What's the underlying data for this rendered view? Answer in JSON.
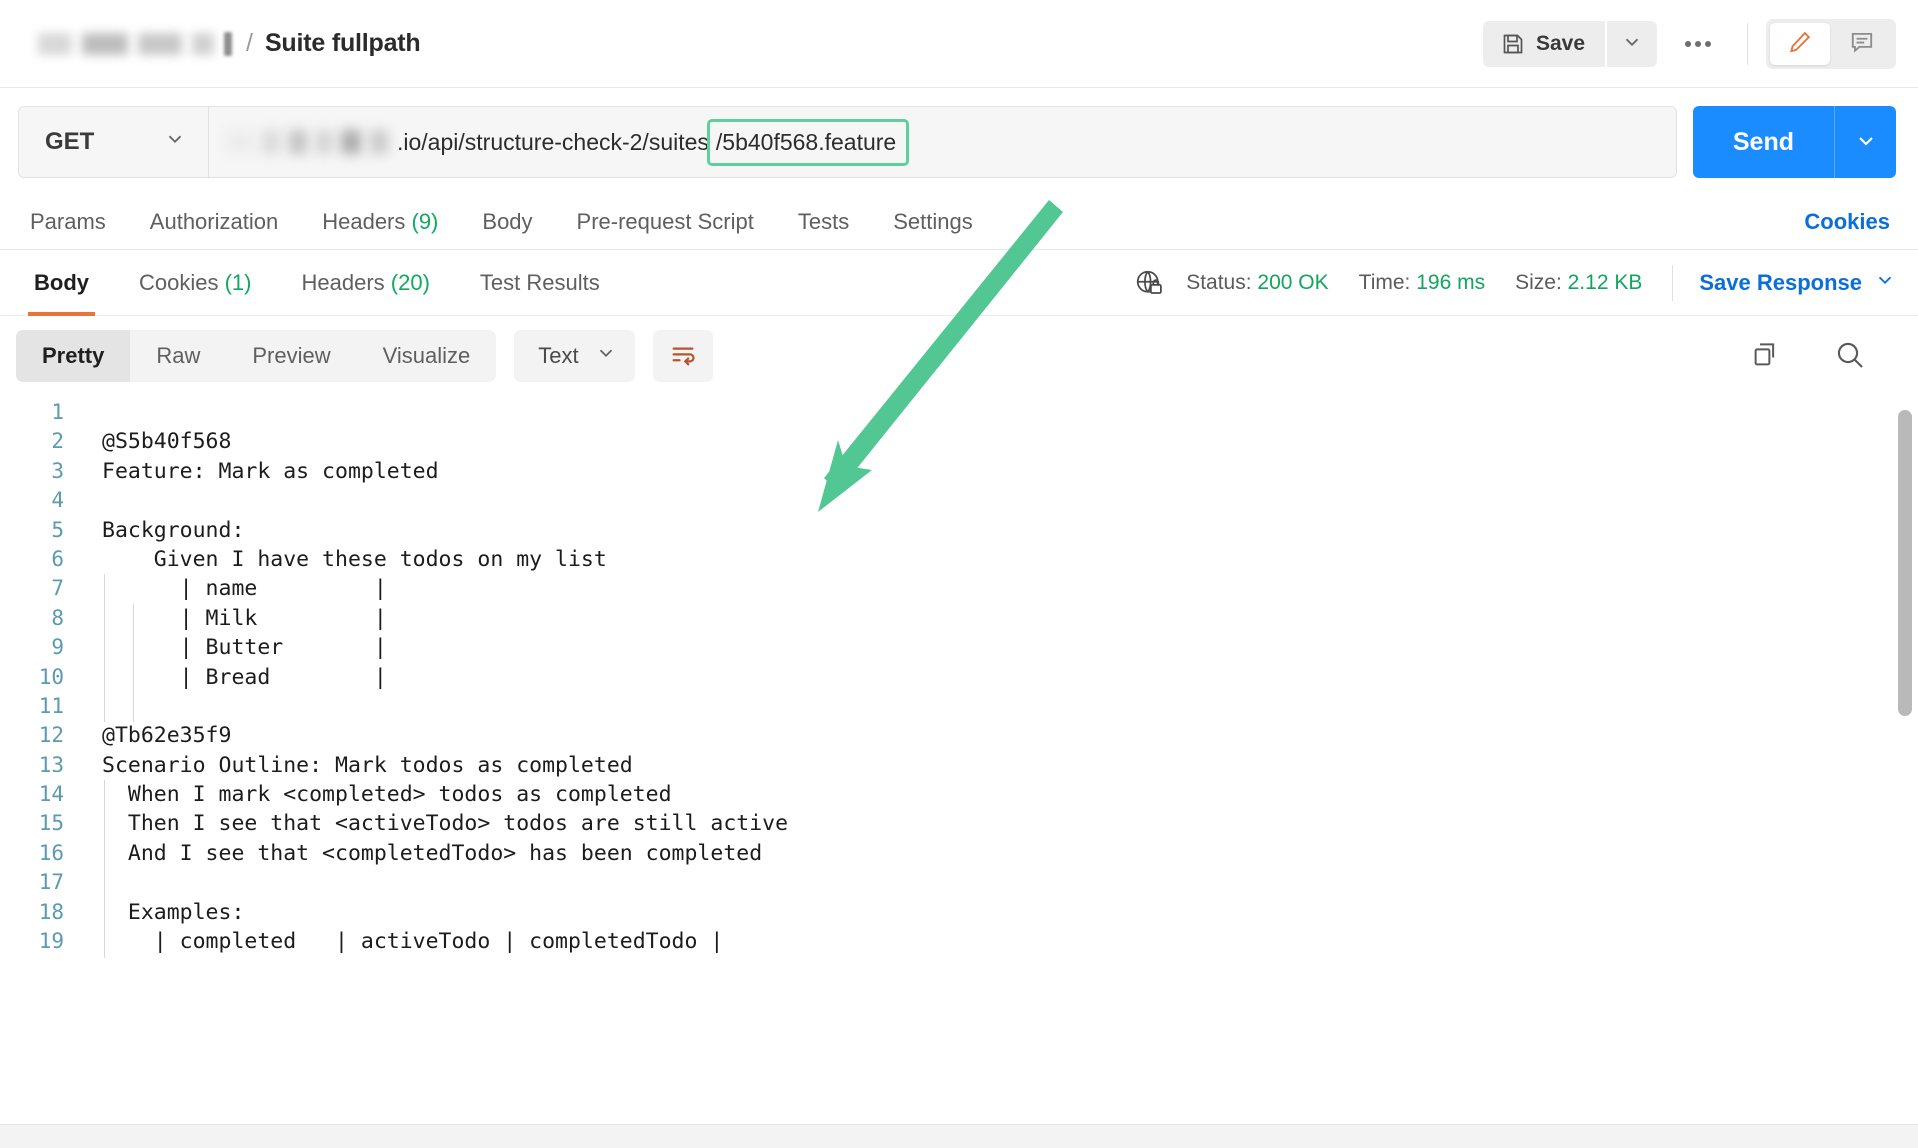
{
  "header": {
    "breadcrumb_redacted": true,
    "breadcrumb_separator": "/",
    "title": "Suite fullpath",
    "save_label": "Save",
    "save_caret_icon": "chevron-down-icon",
    "save_icon": "floppy-disk-icon",
    "more_icon": "three-dots-icon",
    "edit_icon": "pencil-icon",
    "comment_icon": "comment-icon"
  },
  "request": {
    "method": "GET",
    "method_caret_icon": "chevron-down-icon",
    "url_visible": ".io/api/structure-check-2/suites",
    "url_highlighted": "/5b40f568.feature",
    "highlight_color": "#5ecf9d",
    "send_label": "Send",
    "send_caret_icon": "chevron-down-icon",
    "send_color": "#1a8cff",
    "tabs": [
      {
        "label": "Params",
        "count": ""
      },
      {
        "label": "Authorization",
        "count": ""
      },
      {
        "label": "Headers",
        "count": "(9)"
      },
      {
        "label": "Body",
        "count": ""
      },
      {
        "label": "Pre-request Script",
        "count": ""
      },
      {
        "label": "Tests",
        "count": ""
      },
      {
        "label": "Settings",
        "count": ""
      }
    ],
    "cookies_link": "Cookies"
  },
  "response": {
    "tabs": [
      {
        "label": "Body",
        "count": "",
        "active": true
      },
      {
        "label": "Cookies",
        "count": "(1)",
        "active": false
      },
      {
        "label": "Headers",
        "count": "(20)",
        "active": false
      },
      {
        "label": "Test Results",
        "count": "",
        "active": false
      }
    ],
    "globe_icon": "globe-lock-icon",
    "status_label": "Status:",
    "status_value": "200 OK",
    "time_label": "Time:",
    "time_value": "196 ms",
    "size_label": "Size:",
    "size_value": "2.12 KB",
    "save_response_label": "Save Response",
    "save_response_caret_icon": "chevron-down-icon",
    "accent_orange": "#e8743b",
    "accent_green": "#12a55d",
    "accent_blue": "#0a6fd8"
  },
  "body_toolbar": {
    "view_modes": [
      {
        "label": "Pretty",
        "active": true
      },
      {
        "label": "Raw",
        "active": false
      },
      {
        "label": "Preview",
        "active": false
      },
      {
        "label": "Visualize",
        "active": false
      }
    ],
    "format_selected": "Text",
    "format_caret_icon": "chevron-down-icon",
    "wrap_icon": "word-wrap-icon",
    "copy_icon": "copy-icon",
    "search_icon": "search-icon"
  },
  "code": {
    "lines": [
      {
        "n": "1",
        "text": ""
      },
      {
        "n": "2",
        "text": "@S5b40f568"
      },
      {
        "n": "3",
        "text": "Feature: Mark as completed"
      },
      {
        "n": "4",
        "text": ""
      },
      {
        "n": "5",
        "text": "Background:"
      },
      {
        "n": "6",
        "text": "    Given I have these todos on my list"
      },
      {
        "n": "7",
        "text": "      | name         |"
      },
      {
        "n": "8",
        "text": "      | Milk         |"
      },
      {
        "n": "9",
        "text": "      | Butter       |"
      },
      {
        "n": "10",
        "text": "      | Bread        |"
      },
      {
        "n": "11",
        "text": ""
      },
      {
        "n": "12",
        "text": "@Tb62e35f9"
      },
      {
        "n": "13",
        "text": "Scenario Outline: Mark todos as completed"
      },
      {
        "n": "14",
        "text": "  When I mark <completed> todos as completed"
      },
      {
        "n": "15",
        "text": "  Then I see that <activeTodo> todos are still active"
      },
      {
        "n": "16",
        "text": "  And I see that <completedTodo> has been completed"
      },
      {
        "n": "17",
        "text": ""
      },
      {
        "n": "18",
        "text": "  Examples:"
      },
      {
        "n": "19",
        "text": "    | completed   | activeTodo | completedTodo |"
      }
    ]
  },
  "annotation": {
    "type": "arrow",
    "color": "#52c794",
    "from": "url-highlight",
    "to": "response-body-code"
  }
}
